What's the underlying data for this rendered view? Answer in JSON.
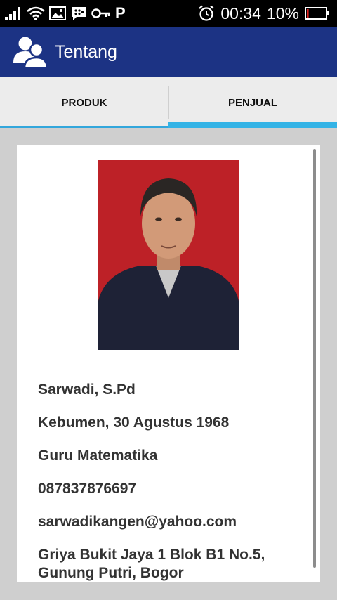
{
  "status_bar": {
    "time": "00:34",
    "battery_percent": "10%",
    "battery_level": 0.1,
    "icons": [
      "signal-icon",
      "wifi-icon",
      "image-icon",
      "bbm-icon",
      "key-icon",
      "p-icon",
      "alarm-icon",
      "battery-icon"
    ],
    "p_glyph": "P"
  },
  "app_bar": {
    "title": "Tentang",
    "icon": "users-icon",
    "color": "#1c3384"
  },
  "tabs": [
    {
      "label": "PRODUK",
      "selected": false
    },
    {
      "label": "PENJUAL",
      "selected": true
    }
  ],
  "accent_color": "#33b3e6",
  "seller": {
    "photo": "seller-photo",
    "name": "Sarwadi, S.Pd",
    "birth": "Kebumen, 30 Agustus 1968",
    "occupation": "Guru Matematika",
    "phone": "087837876697",
    "email": "sarwadikangen@yahoo.com",
    "address": "Griya Bukit Jaya 1 Blok B1 No.5, Gunung Putri, Bogor"
  }
}
